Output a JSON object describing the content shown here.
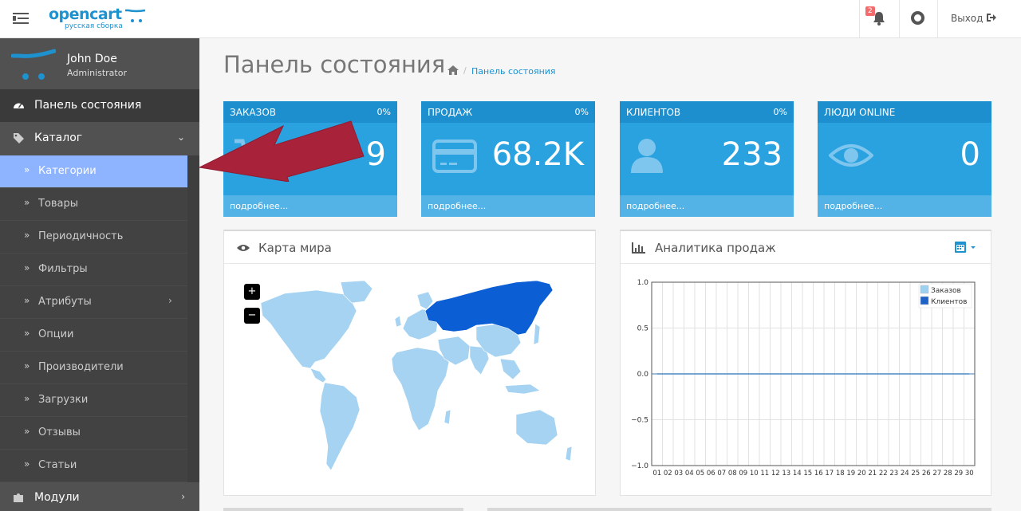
{
  "header": {
    "logo_text": "opencart",
    "logo_subtitle": "русская сборка",
    "notification_count": "2",
    "logout_label": "Выход"
  },
  "profile": {
    "name": "John Doe",
    "role": "Administrator"
  },
  "sidebar": {
    "dashboard_label": "Панель состояния",
    "catalog_label": "Каталог",
    "modules_label": "Модули",
    "catalog_items": [
      {
        "label": "Категории",
        "active": true
      },
      {
        "label": "Товары"
      },
      {
        "label": "Периодичность"
      },
      {
        "label": "Фильтры"
      },
      {
        "label": "Атрибуты",
        "has_submenu": true
      },
      {
        "label": "Опции"
      },
      {
        "label": "Производители"
      },
      {
        "label": "Загрузки"
      },
      {
        "label": "Отзывы"
      },
      {
        "label": "Статьи"
      }
    ]
  },
  "page": {
    "title": "Панель состояния",
    "breadcrumb": "Панель состояния"
  },
  "tiles": [
    {
      "title": "ЗАКАЗОВ",
      "percent": "0%",
      "value": "9",
      "more": "подробнее...",
      "icon": "shopping-cart-icon"
    },
    {
      "title": "ПРОДАЖ",
      "percent": "0%",
      "value": "68.2K",
      "more": "подробнее...",
      "icon": "credit-card-icon"
    },
    {
      "title": "КЛИЕНТОВ",
      "percent": "0%",
      "value": "233",
      "more": "подробнее...",
      "icon": "user-icon"
    },
    {
      "title": "ЛЮДИ ONLINE",
      "percent": "",
      "value": "0",
      "more": "подробнее...",
      "icon": "eye-icon"
    }
  ],
  "world_map": {
    "title": "Карта мира",
    "zoom_in": "+",
    "zoom_out": "−",
    "highlighted_country": "Russia"
  },
  "sales_chart": {
    "title": "Аналитика продаж"
  },
  "chart_data": {
    "type": "line",
    "title": "",
    "xlabel": "",
    "ylabel": "",
    "x": [
      "01",
      "02",
      "03",
      "04",
      "05",
      "06",
      "07",
      "08",
      "09",
      "10",
      "11",
      "12",
      "13",
      "14",
      "15",
      "16",
      "17",
      "18",
      "19",
      "20",
      "21",
      "22",
      "23",
      "24",
      "25",
      "26",
      "27",
      "28",
      "29",
      "30"
    ],
    "series": [
      {
        "name": "Заказов",
        "color": "#9cd0f0",
        "values": [
          0,
          0,
          0,
          0,
          0,
          0,
          0,
          0,
          0,
          0,
          0,
          0,
          0,
          0,
          0,
          0,
          0,
          0,
          0,
          0,
          0,
          0,
          0,
          0,
          0,
          0,
          0,
          0,
          0,
          0
        ]
      },
      {
        "name": "Клиентов",
        "color": "#1e62c8",
        "values": [
          0,
          0,
          0,
          0,
          0,
          0,
          0,
          0,
          0,
          0,
          0,
          0,
          0,
          0,
          0,
          0,
          0,
          0,
          0,
          0,
          0,
          0,
          0,
          0,
          0,
          0,
          0,
          0,
          0,
          0
        ]
      }
    ],
    "yticks": [
      "1.0",
      "0.5",
      "0.0",
      "−0.5",
      "−1.0"
    ],
    "ylim": [
      -1,
      1
    ],
    "grid": true,
    "legend": "top-right"
  },
  "colors": {
    "brand": "#1e91cf",
    "tile": "#2ba2e0",
    "sidebar": "#515151",
    "active_item": "#8fb4ff",
    "arrow": "#a8233a"
  }
}
